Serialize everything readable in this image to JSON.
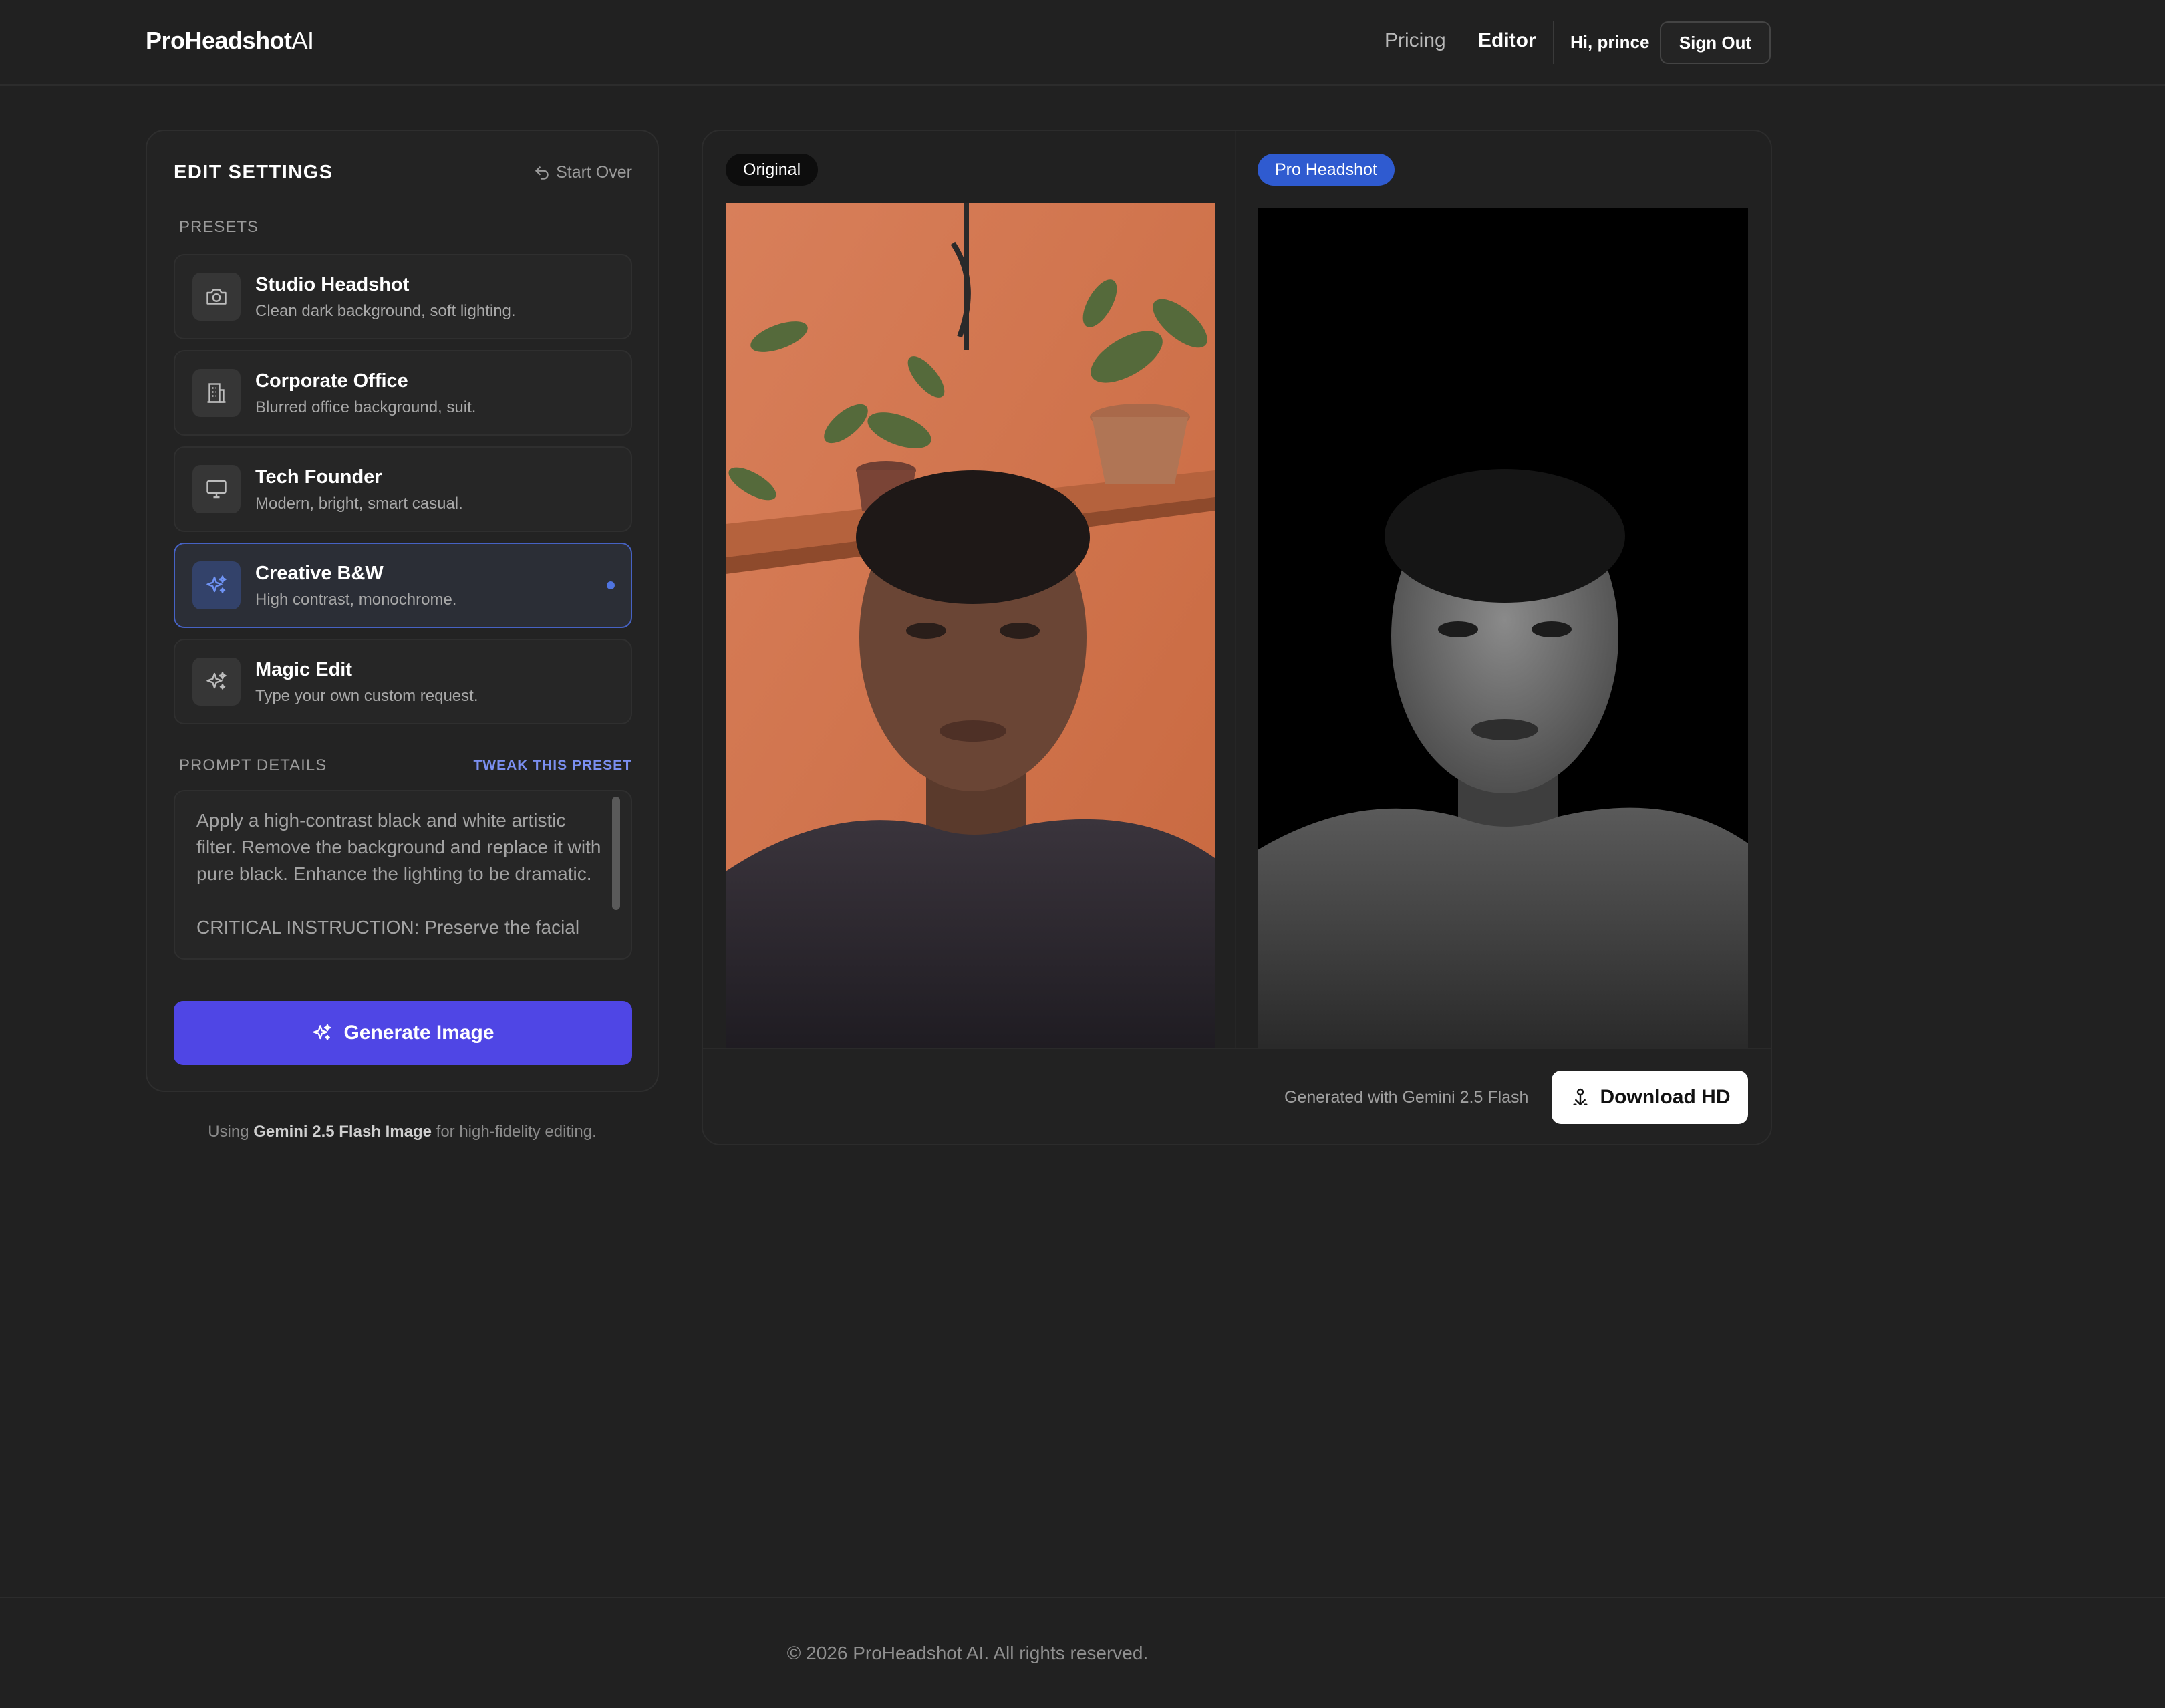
{
  "brand": {
    "name_main": "ProHeadshot",
    "name_suffix": "AI"
  },
  "nav": {
    "pricing": "Pricing",
    "editor": "Editor",
    "greeting": "Hi, prince",
    "sign_out": "Sign Out"
  },
  "settings": {
    "title": "EDIT SETTINGS",
    "start_over": "Start Over",
    "presets_label": "PRESETS",
    "presets": [
      {
        "title": "Studio Headshot",
        "desc": "Clean dark background, soft lighting.",
        "icon": "camera-icon"
      },
      {
        "title": "Corporate Office",
        "desc": "Blurred office background, suit.",
        "icon": "building-icon"
      },
      {
        "title": "Tech Founder",
        "desc": "Modern, bright, smart casual.",
        "icon": "monitor-icon"
      },
      {
        "title": "Creative B&W",
        "desc": "High contrast, monochrome.",
        "icon": "sparkles-icon",
        "active": true
      },
      {
        "title": "Magic Edit",
        "desc": "Type your own custom request.",
        "icon": "sparkles-icon"
      }
    ],
    "prompt_label": "PROMPT DETAILS",
    "tweak_label": "TWEAK THIS PRESET",
    "prompt_text": "Apply a high-contrast black and white artistic filter. Remove the background and replace it with pure black. Enhance the lighting to be dramatic.\n\nCRITICAL INSTRUCTION: Preserve the facial",
    "generate_label": "Generate Image",
    "accent_color": "#4f46e5"
  },
  "using_note": {
    "prefix": "Using",
    "model": "Gemini 2.5 Flash Image",
    "suffix": "for high-fidelity editing."
  },
  "compare": {
    "original_badge": "Original",
    "pro_badge": "Pro Headshot",
    "generated_note": "Generated with Gemini 2.5 Flash",
    "download_label": "Download HD"
  },
  "footer": {
    "text": "© 2026 ProHeadshot AI. All rights reserved."
  }
}
